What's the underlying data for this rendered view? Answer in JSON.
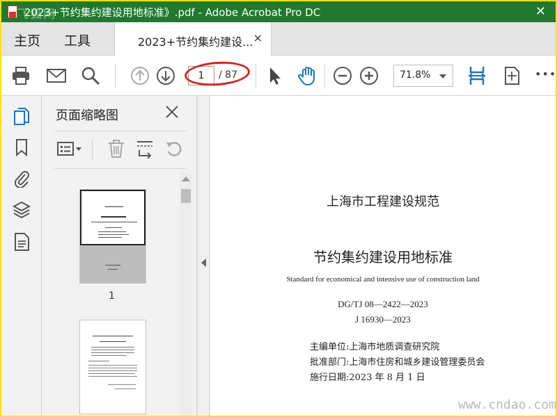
{
  "window": {
    "title": "2023+节约集约建设用地标准》.pdf - Adobe Acrobat Pro DC",
    "watermark": "飞狐网"
  },
  "menubar": {
    "home_label": "主页",
    "tools_label": "工具",
    "tab_label": "2023+节约集约建设...",
    "tab_close": "×"
  },
  "toolbar": {
    "page_current": "1",
    "page_total": "/ 87",
    "zoom": "71.8%",
    "more": "•••"
  },
  "panel": {
    "title": "页面缩略图",
    "thumbnails": [
      {
        "page": "1"
      }
    ]
  },
  "document": {
    "series": "上海市工程建设规范",
    "title": "节约集约建设用地标准",
    "title_en": "Standard for economical and intensive use of construction land",
    "code1": "DG/TJ 08—2422—2023",
    "code2": "J 16930—2023",
    "editor": "主编单位:上海市地质调查研究院",
    "approver": "批准部门:上海市住房和城乡建设管理委员会",
    "effective": "施行日期:2023 年 8 月 1 日"
  },
  "site_watermark": "www.cndao.com",
  "colors": {
    "titlebar": "#1f7a2e",
    "accent": "#1a73c7",
    "frame_border": "#ffe100",
    "highlight": "#d9201c"
  }
}
